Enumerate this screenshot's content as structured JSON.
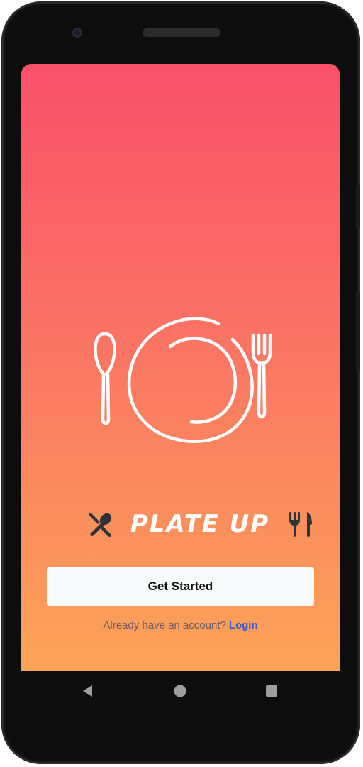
{
  "app": {
    "brand_name": "PLATE UP"
  },
  "main": {
    "get_started_label": "Get Started",
    "login_prompt": "Already have an account?",
    "login_link": "Login"
  },
  "icons": {
    "illustration": "plate-with-spoon-and-fork",
    "logo_left": "crossed-knife-spoon",
    "logo_right": "fork-knife",
    "nav_back": "back-triangle",
    "nav_home": "home-circle",
    "nav_recents": "recents-square"
  },
  "colors": {
    "gradient_top": "#f9506a",
    "gradient_bottom": "#fca458",
    "button_bg": "#f9fafc",
    "link": "#3c57c9",
    "logo_icons": "#2f3236"
  }
}
